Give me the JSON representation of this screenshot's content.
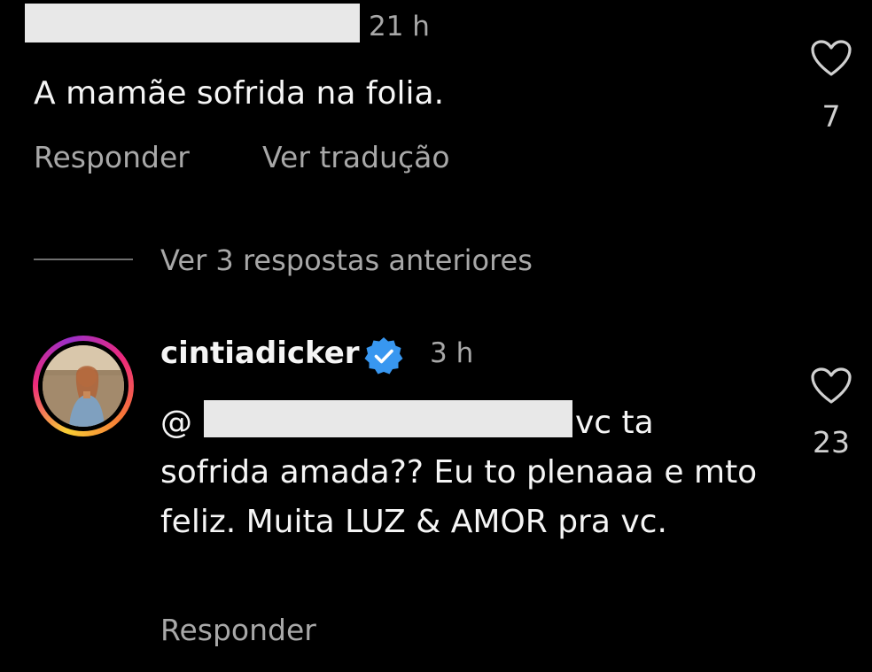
{
  "first_comment": {
    "username_redacted": true,
    "time": "21 h",
    "text": "A mamãe sofrida na folia.",
    "reply_label": "Responder",
    "translate_label": "Ver tradução",
    "likes": "7"
  },
  "view_previous": {
    "label": "Ver 3 respostas anteriores"
  },
  "reply_comment": {
    "username": "cintiadicker",
    "verified": true,
    "time": "3 h",
    "mention_prefix": "@",
    "text_first_line_tail": "vc ta",
    "text_rest": "sofrida amada?? Eu to plenaaa e mto feliz. Muita LUZ & AMOR pra vc.",
    "reply_label": "Responder",
    "likes": "23"
  },
  "colors": {
    "background": "#000000",
    "primary_text": "#f5f5f5",
    "secondary_text": "#a8a8a8",
    "verified_badge": "#3897f0",
    "redaction": "#e8e8e8"
  },
  "icons": {
    "like": "heart-outline-icon",
    "verified": "verified-badge-icon"
  }
}
